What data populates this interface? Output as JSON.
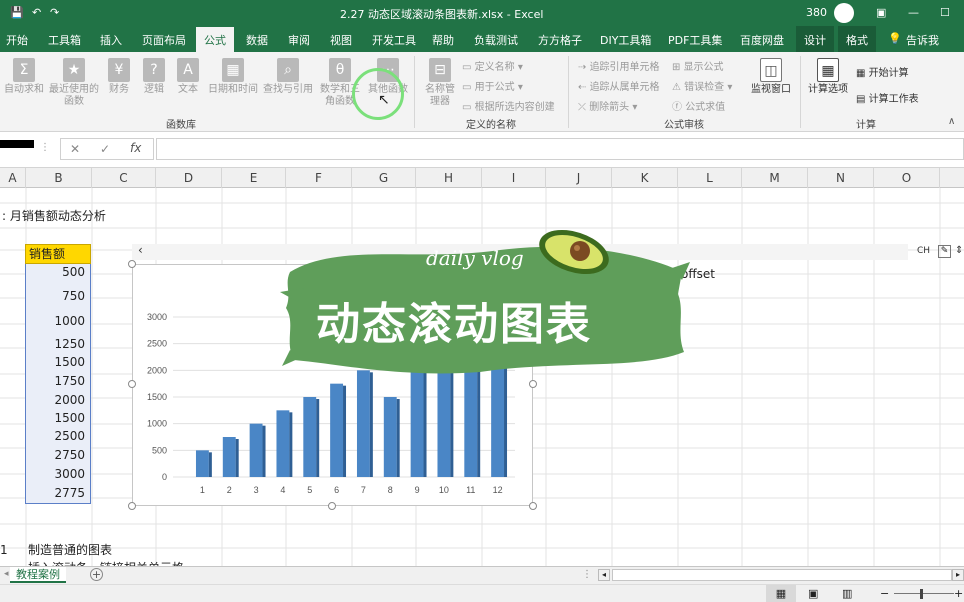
{
  "titlebar": {
    "filename": "2.27 动态区域滚动条图表新.xlsx",
    "app": "Excel",
    "user_number": "380"
  },
  "tabs": [
    "开始",
    "工具箱",
    "插入",
    "页面布局",
    "公式",
    "数据",
    "审阅",
    "视图",
    "开发工具",
    "帮助",
    "负载测试",
    "方方格子",
    "DIY工具箱",
    "PDF工具集",
    "百度网盘",
    "设计",
    "格式",
    "告诉我"
  ],
  "active_tab": "公式",
  "ribbon": {
    "function_library": {
      "group_label": "函数库",
      "buttons": [
        "自动求和",
        "最近使用的函数",
        "财务",
        "逻辑",
        "文本",
        "日期和时间",
        "查找与引用",
        "数学和三角函数",
        "其他函数"
      ]
    },
    "defined_names": {
      "group_label": "定义的名称",
      "manager": "名称管理器",
      "items": [
        "定义名称",
        "用于公式",
        "根据所选内容创建"
      ]
    },
    "formula_auditing": {
      "group_label": "公式审核",
      "items_left": [
        "追踪引用单元格",
        "追踪从属单元格",
        "删除箭头"
      ],
      "items_right": [
        "显示公式",
        "错误检查",
        "公式求值"
      ],
      "watch": "监视窗口"
    },
    "calculation": {
      "group_label": "计算",
      "options": "计算选项",
      "calc_now": "开始计算",
      "calc_sheet": "计算工作表"
    }
  },
  "formula_bar": {
    "fx": "fx",
    "cancel": "✕",
    "confirm": "✓"
  },
  "columns": [
    "A",
    "B",
    "C",
    "D",
    "E",
    "F",
    "G",
    "H",
    "I",
    "J",
    "K",
    "L",
    "M",
    "N",
    "O"
  ],
  "sheet": {
    "title_cell": ":  月销售额动态分析",
    "header": "销售额",
    "values": [
      "500",
      "750",
      "1000",
      "1250",
      "1500",
      "1750",
      "2000",
      "1500",
      "2500",
      "2750",
      "3000",
      "2775"
    ],
    "offset_label": "offset",
    "notes": [
      "1",
      "制造普通的图表"
    ],
    "partial_note": "插入滚动条，链接相关单元格",
    "scroll_left": "‹"
  },
  "overlay": {
    "script": "daily vlog",
    "title": "动态滚动图表"
  },
  "chart_data": {
    "type": "bar",
    "categories": [
      "1",
      "2",
      "3",
      "4",
      "5",
      "6",
      "7",
      "8",
      "9",
      "10",
      "11",
      "12"
    ],
    "values": [
      500,
      750,
      1000,
      1250,
      1500,
      1750,
      2000,
      1500,
      2500,
      2750,
      3000,
      2775
    ],
    "yticks": [
      "0",
      "500",
      "1000",
      "1500",
      "2000",
      "2500",
      "3000"
    ],
    "ylim": [
      0,
      3000
    ],
    "color": "#4a86c6"
  },
  "sheet_tabs": {
    "active": "教程案例",
    "add": "+"
  },
  "ch_indicator": "CH"
}
